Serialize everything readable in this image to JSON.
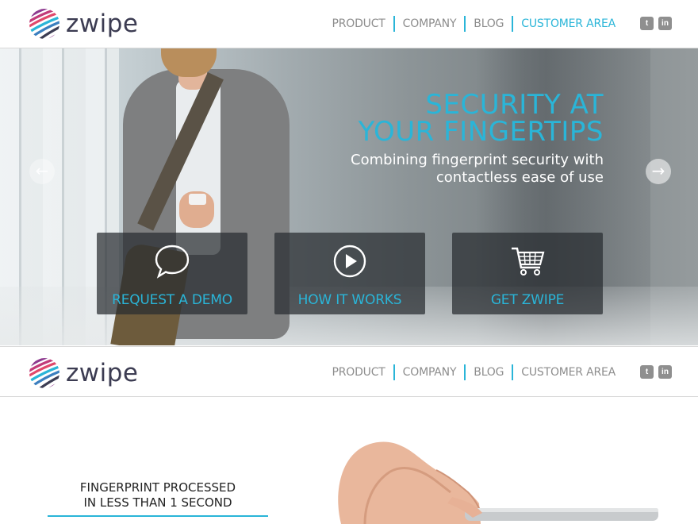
{
  "brand": {
    "name": "zwipe",
    "colors": {
      "accent": "#2ab5d8",
      "text_dark": "#3c3c52",
      "nav_gray": "#8d8d8d"
    }
  },
  "nav_primary": {
    "items": [
      {
        "label": "PRODUCT",
        "active": false
      },
      {
        "label": "COMPANY",
        "active": false
      },
      {
        "label": "BLOG",
        "active": false
      },
      {
        "label": "CUSTOMER AREA",
        "active": true
      }
    ],
    "social": [
      {
        "icon": "twitter-icon",
        "glyph": "t"
      },
      {
        "icon": "linkedin-icon",
        "glyph": "in"
      }
    ]
  },
  "hero": {
    "title_line1": "SECURITY AT",
    "title_line2": "YOUR FINGERTIPS",
    "subtitle_line1": "Combining fingerprint security with",
    "subtitle_line2": "contactless ease of use",
    "prev_arrow": "←",
    "next_arrow": "→",
    "ctas": [
      {
        "label": "REQUEST A DEMO",
        "icon": "speech-bubble-icon"
      },
      {
        "label": "HOW IT WORKS",
        "icon": "play-icon"
      },
      {
        "label": "GET ZWIPE",
        "icon": "shopping-cart-icon"
      }
    ]
  },
  "nav_secondary": {
    "items": [
      {
        "label": "PRODUCT",
        "active": false
      },
      {
        "label": "COMPANY",
        "active": false
      },
      {
        "label": "BLOG",
        "active": false
      },
      {
        "label": "CUSTOMER AREA",
        "active": false
      }
    ],
    "social": [
      {
        "icon": "twitter-icon",
        "glyph": "t"
      },
      {
        "icon": "linkedin-icon",
        "glyph": "in"
      }
    ]
  },
  "feature": {
    "line1": "FINGERPRINT PROCESSED",
    "line2": "IN LESS THAN 1 SECOND"
  }
}
